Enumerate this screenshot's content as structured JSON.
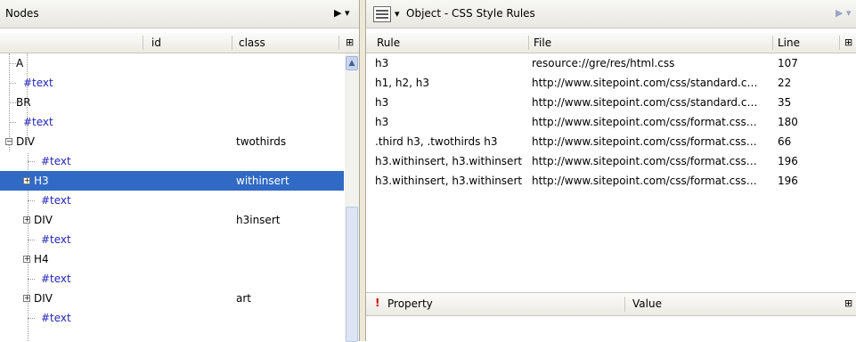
{
  "left": {
    "title": "Nodes",
    "columns": {
      "id": "id",
      "class": "class"
    },
    "rows": [
      {
        "tag": "A",
        "class": "",
        "kind": "text"
      },
      {
        "tag": "#text",
        "class": "",
        "kind": "link"
      },
      {
        "tag": "BR",
        "class": "",
        "kind": "text"
      },
      {
        "tag": "#text",
        "class": "",
        "kind": "link"
      },
      {
        "tag": "DIV",
        "class": "twothirds",
        "kind": "text"
      },
      {
        "tag": "#text",
        "class": "",
        "kind": "link"
      },
      {
        "tag": "H3",
        "class": "withinsert",
        "kind": "selected"
      },
      {
        "tag": "#text",
        "class": "",
        "kind": "link"
      },
      {
        "tag": "DIV",
        "class": "h3insert",
        "kind": "text"
      },
      {
        "tag": "#text",
        "class": "",
        "kind": "link"
      },
      {
        "tag": "H4",
        "class": "",
        "kind": "text"
      },
      {
        "tag": "#text",
        "class": "",
        "kind": "link"
      },
      {
        "tag": "DIV",
        "class": "art",
        "kind": "text"
      },
      {
        "tag": "#text",
        "class": "",
        "kind": "link"
      }
    ]
  },
  "right": {
    "title": "Object - CSS Style Rules",
    "columns": {
      "rule": "Rule",
      "file": "File",
      "line": "Line"
    },
    "rules": [
      {
        "rule": "h3",
        "file": "resource://gre/res/html.css",
        "line": "107"
      },
      {
        "rule": "h1, h2, h3",
        "file": "http://www.sitepoint.com/css/standard.c…",
        "line": "22"
      },
      {
        "rule": "h3",
        "file": "http://www.sitepoint.com/css/standard.c…",
        "line": "35"
      },
      {
        "rule": "h3",
        "file": "http://www.sitepoint.com/css/format.css…",
        "line": "180"
      },
      {
        "rule": ".third h3, .twothirds h3",
        "file": "http://www.sitepoint.com/css/format.css…",
        "line": "66"
      },
      {
        "rule": "h3.withinsert, h3.withinsert",
        "file": "http://www.sitepoint.com/css/format.css…",
        "line": "196"
      },
      {
        "rule": "h3.withinsert, h3.withinsert",
        "file": "http://www.sitepoint.com/css/format.css…",
        "line": "196"
      }
    ],
    "property_header": {
      "flag": "!",
      "property": "Property",
      "value": "Value"
    }
  },
  "icons": {
    "nav_arrow": "▸ ▾",
    "expand": "+",
    "collapse": "−",
    "columns": "column-picker"
  }
}
